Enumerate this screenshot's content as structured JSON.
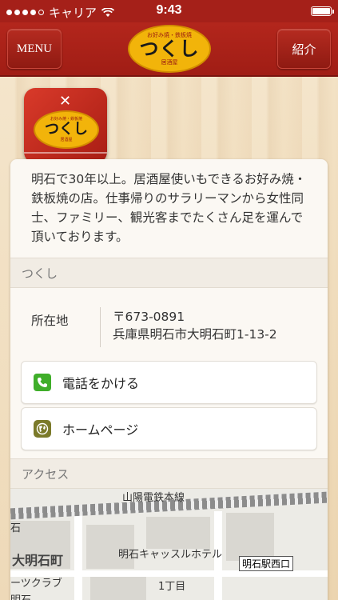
{
  "status_bar": {
    "carrier": "キャリア",
    "time": "9:43"
  },
  "nav": {
    "menu_label": "MENU",
    "intro_label": "紹介",
    "logo_small": "お好み焼・鉄板焼",
    "logo_main": "つくし",
    "logo_sub": "居酒屋"
  },
  "app_icon": {
    "badge_small": "お好み焼・鉄板焼",
    "badge_main": "つくし",
    "badge_sub": "居酒屋"
  },
  "card": {
    "intro_text": "明石で30年以上。居酒屋使いもできるお好み焼・鉄板焼の店。仕事帰りのサラリーマンから女性同士、ファミリー、観光客までたくさん足を運んで頂いております。",
    "name_header": "つくし",
    "address_label": "所在地",
    "postal_code": "〒673-0891",
    "address": "兵庫県明石市大明石町1-13-2",
    "phone_button": "電話をかける",
    "homepage_button": "ホームページ",
    "access_header": "アクセス"
  },
  "map": {
    "rail_line": "山陽電鉄本線",
    "district": "大明石町",
    "hotel": "明石キャッスルホテル",
    "station": "明石駅西口",
    "chome": "1丁目",
    "club": "ーツクラブ",
    "left_char": "石",
    "bottom_text": "明石"
  },
  "colors": {
    "nav_red": "#a52019",
    "logo_yellow": "#f2b40a",
    "phone_green": "#3fae2a"
  },
  "icons": {
    "wifi": "wifi-icon",
    "battery": "battery-icon",
    "phone": "phone-icon",
    "globe": "globe-icon"
  }
}
